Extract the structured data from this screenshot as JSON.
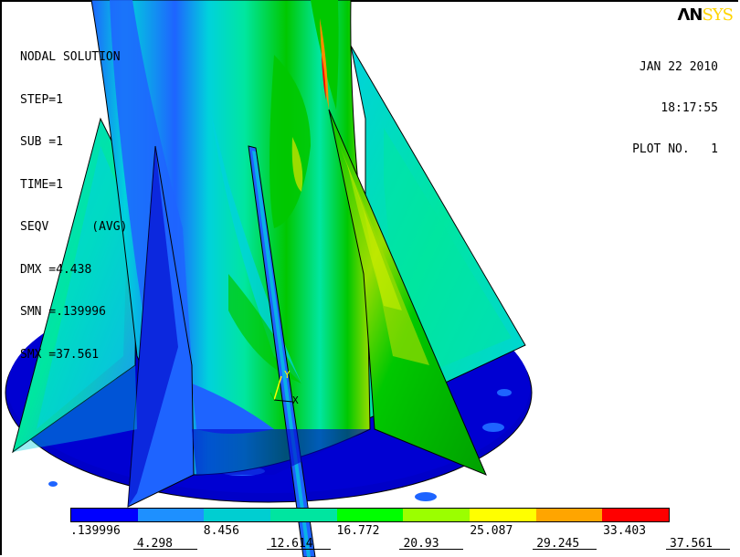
{
  "plot_info": {
    "lines": [
      "NODAL SOLUTION",
      "STEP=1",
      "SUB =1",
      "TIME=1",
      "SEQV      (AVG)",
      "DMX =4.438",
      "SMN =.139996",
      "SMX =37.561"
    ]
  },
  "stamp": {
    "date": "JAN 22 2010",
    "time": "18:17:55",
    "plot_no": "PLOT NO.   1"
  },
  "logo": {
    "part1": "ΛN",
    "part2": "SYS"
  },
  "triad": {
    "y_label": "Y",
    "x_label": "X"
  },
  "legend": {
    "colors": [
      "#0000ff",
      "#1e90ff",
      "#00ced1",
      "#00e5a0",
      "#00ff00",
      "#9bff00",
      "#ffff00",
      "#ffa500",
      "#ff0000"
    ],
    "labels_upper": [
      ".139996",
      "8.456",
      "16.772",
      "25.087",
      "33.403"
    ],
    "labels_lower": [
      "4.298",
      "12.614",
      "20.93",
      "29.245",
      "37.561"
    ]
  },
  "colors": {
    "deep_blue": "#0000c8",
    "blue": "#1e64ff",
    "cyan": "#00d2dc",
    "teal_green": "#00e6a0",
    "green": "#00c800",
    "lime": "#9bdc00",
    "yellow": "#ffff00",
    "orange": "#ff8c00",
    "red": "#ff0000"
  }
}
